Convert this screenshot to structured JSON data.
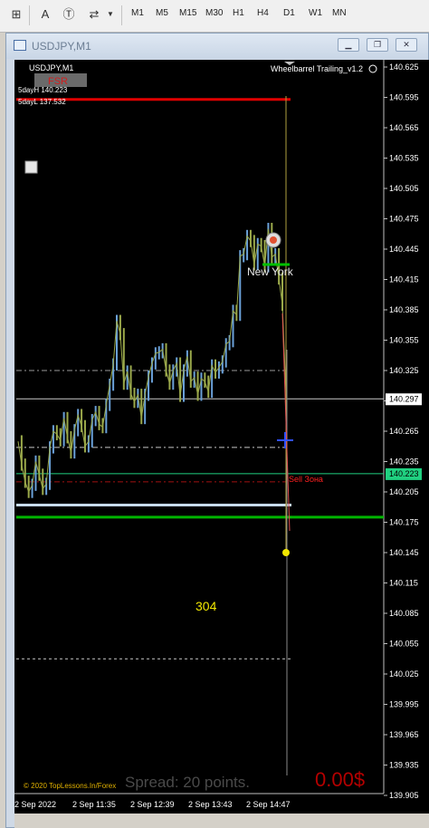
{
  "toolbar": {
    "text_tool_label": "A",
    "timeframes": [
      "M1",
      "M5",
      "M15",
      "M30",
      "H1",
      "H4",
      "D1",
      "W1",
      "MN"
    ]
  },
  "window": {
    "title": "USDJPY,M1"
  },
  "chart": {
    "symbol_label": "USDJPY,M1",
    "indicator_label": "Wheelbarrel Trailing_v1.2",
    "fsr_label": "FSR",
    "five_day_high": "5dayH 140.223",
    "five_day_low": "5dayL 137.532",
    "session_label": "New York",
    "sell_zone_label": "Sell Зона",
    "count_label": "304",
    "copyright": "© 2020 TopLessons.In/Forex",
    "spread_label": "Spread: 20 points.",
    "profit_label": "0.00$",
    "current_price_tag": "140.297",
    "bid_price_tag": "140.223",
    "colors": {
      "background": "#000000",
      "candles": "#9aa84a",
      "upcandles": "#6aa0d8",
      "red_line": "#e00000",
      "green_line": "#00b400",
      "sell_zone": "#ff2020",
      "profit": "#b40000"
    }
  },
  "chart_data": {
    "type": "line",
    "title": "",
    "y_ticks": [
      "140.625",
      "140.595",
      "140.565",
      "140.535",
      "140.505",
      "140.475",
      "140.445",
      "140.415",
      "140.385",
      "140.355",
      "140.325",
      "140.295",
      "140.265",
      "140.235",
      "140.205",
      "140.175",
      "140.145",
      "140.115",
      "140.085",
      "140.055",
      "140.025",
      "139.995",
      "139.965",
      "139.935",
      "139.905"
    ],
    "x_ticks": [
      "2 Sep 2022",
      "2 Sep 11:35",
      "2 Sep 12:39",
      "2 Sep 13:43",
      "2 Sep 14:47"
    ],
    "ylim": [
      139.905,
      140.625
    ],
    "series": [
      {
        "x": [
          0,
          2,
          4,
          6,
          8,
          10,
          12,
          14,
          16,
          18,
          20,
          22,
          24,
          26,
          28,
          30,
          32,
          34,
          36,
          38,
          40,
          42,
          44,
          46,
          48,
          50,
          52,
          54,
          56,
          58,
          60,
          62,
          64,
          66,
          68,
          70,
          72,
          74,
          76,
          78,
          80,
          82,
          84,
          86,
          88,
          90,
          92,
          94,
          96,
          98,
          100,
          102,
          104,
          106,
          108,
          110,
          112,
          114,
          116,
          118,
          120,
          122,
          124,
          126,
          128,
          130,
          132,
          134,
          136,
          138,
          140,
          142,
          144,
          146,
          148,
          150
        ],
        "values": [
          140.255,
          140.232,
          140.215,
          140.205,
          140.212,
          140.235,
          140.222,
          140.208,
          140.213,
          140.249,
          140.265,
          140.262,
          140.256,
          140.278,
          140.259,
          140.244,
          140.266,
          140.281,
          140.27,
          140.25,
          140.255,
          140.276,
          140.284,
          140.272,
          140.269,
          140.291,
          140.311,
          140.331,
          140.374,
          140.361,
          140.312,
          140.324,
          140.302,
          140.294,
          140.301,
          140.278,
          140.301,
          140.319,
          140.332,
          140.342,
          140.343,
          140.346,
          140.325,
          140.312,
          140.325,
          140.332,
          140.3,
          140.325,
          140.339,
          140.314,
          140.318,
          140.301,
          140.317,
          140.314,
          140.304,
          140.33,
          140.323,
          140.328,
          140.334,
          140.351,
          140.354,
          140.384,
          140.38,
          140.438,
          140.44,
          140.458,
          140.453,
          140.43,
          140.45,
          140.448,
          140.428,
          140.465,
          140.437,
          140.44,
          140.416,
          140.39
        ]
      }
    ],
    "levels": {
      "five_day_high_line": 140.593,
      "current_price": 140.297,
      "bid": 140.223,
      "blue_white_line": 140.192,
      "green_line": 140.18,
      "dotted_high": 140.325,
      "dotted_mid": 140.249,
      "dotted_low": 140.04
    },
    "drop_end": 140.145
  }
}
